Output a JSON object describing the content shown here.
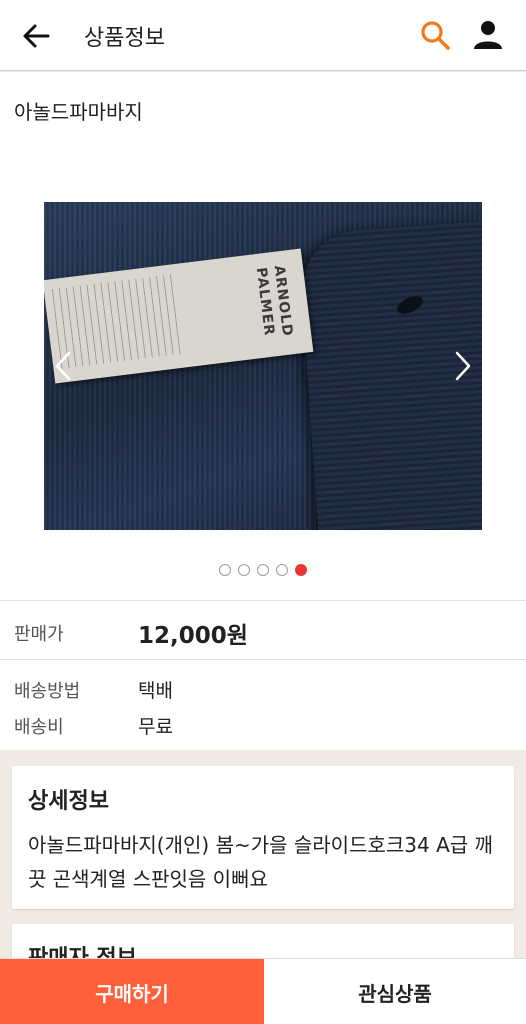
{
  "header": {
    "title": "상품정보",
    "back_icon": "arrow-left-icon",
    "search_icon": "search-icon",
    "user_icon": "user-icon",
    "accent_color": "#f07b1d"
  },
  "product": {
    "name": "아놀드파마바지",
    "image": {
      "brand_text": "ARNOLD PALMER",
      "slide_count": 5,
      "active_slide": 5
    },
    "price_label": "판매가",
    "price": "12,000원",
    "shipping_method_label": "배송방법",
    "shipping_method": "택배",
    "shipping_fee_label": "배송비",
    "shipping_fee": "무료"
  },
  "detail": {
    "title": "상세정보",
    "text": "아놀드파마바지(개인) 봄~가을 슬라이드호크34 A급 깨끗 곤색계열 스판잇음 이뻐요"
  },
  "seller": {
    "title": "판매자 정보"
  },
  "actions": {
    "buy_label": "구매하기",
    "wishlist_label": "관심상품",
    "buy_color": "#ff5f3b",
    "dot_active_color": "#e8363b"
  }
}
